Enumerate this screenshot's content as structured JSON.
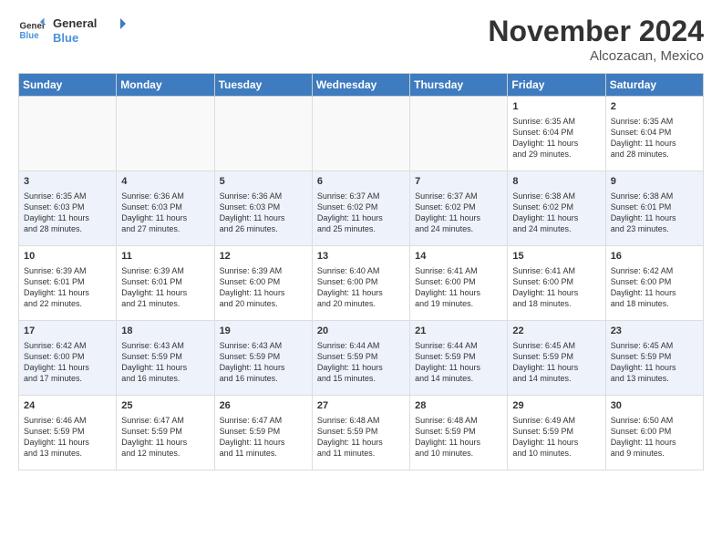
{
  "header": {
    "logo_general": "General",
    "logo_blue": "Blue",
    "month_title": "November 2024",
    "location": "Alcozacan, Mexico"
  },
  "weekdays": [
    "Sunday",
    "Monday",
    "Tuesday",
    "Wednesday",
    "Thursday",
    "Friday",
    "Saturday"
  ],
  "weeks": [
    [
      {
        "day": "",
        "info": ""
      },
      {
        "day": "",
        "info": ""
      },
      {
        "day": "",
        "info": ""
      },
      {
        "day": "",
        "info": ""
      },
      {
        "day": "",
        "info": ""
      },
      {
        "day": "1",
        "info": "Sunrise: 6:35 AM\nSunset: 6:04 PM\nDaylight: 11 hours\nand 29 minutes."
      },
      {
        "day": "2",
        "info": "Sunrise: 6:35 AM\nSunset: 6:04 PM\nDaylight: 11 hours\nand 28 minutes."
      }
    ],
    [
      {
        "day": "3",
        "info": "Sunrise: 6:35 AM\nSunset: 6:03 PM\nDaylight: 11 hours\nand 28 minutes."
      },
      {
        "day": "4",
        "info": "Sunrise: 6:36 AM\nSunset: 6:03 PM\nDaylight: 11 hours\nand 27 minutes."
      },
      {
        "day": "5",
        "info": "Sunrise: 6:36 AM\nSunset: 6:03 PM\nDaylight: 11 hours\nand 26 minutes."
      },
      {
        "day": "6",
        "info": "Sunrise: 6:37 AM\nSunset: 6:02 PM\nDaylight: 11 hours\nand 25 minutes."
      },
      {
        "day": "7",
        "info": "Sunrise: 6:37 AM\nSunset: 6:02 PM\nDaylight: 11 hours\nand 24 minutes."
      },
      {
        "day": "8",
        "info": "Sunrise: 6:38 AM\nSunset: 6:02 PM\nDaylight: 11 hours\nand 24 minutes."
      },
      {
        "day": "9",
        "info": "Sunrise: 6:38 AM\nSunset: 6:01 PM\nDaylight: 11 hours\nand 23 minutes."
      }
    ],
    [
      {
        "day": "10",
        "info": "Sunrise: 6:39 AM\nSunset: 6:01 PM\nDaylight: 11 hours\nand 22 minutes."
      },
      {
        "day": "11",
        "info": "Sunrise: 6:39 AM\nSunset: 6:01 PM\nDaylight: 11 hours\nand 21 minutes."
      },
      {
        "day": "12",
        "info": "Sunrise: 6:39 AM\nSunset: 6:00 PM\nDaylight: 11 hours\nand 20 minutes."
      },
      {
        "day": "13",
        "info": "Sunrise: 6:40 AM\nSunset: 6:00 PM\nDaylight: 11 hours\nand 20 minutes."
      },
      {
        "day": "14",
        "info": "Sunrise: 6:41 AM\nSunset: 6:00 PM\nDaylight: 11 hours\nand 19 minutes."
      },
      {
        "day": "15",
        "info": "Sunrise: 6:41 AM\nSunset: 6:00 PM\nDaylight: 11 hours\nand 18 minutes."
      },
      {
        "day": "16",
        "info": "Sunrise: 6:42 AM\nSunset: 6:00 PM\nDaylight: 11 hours\nand 18 minutes."
      }
    ],
    [
      {
        "day": "17",
        "info": "Sunrise: 6:42 AM\nSunset: 6:00 PM\nDaylight: 11 hours\nand 17 minutes."
      },
      {
        "day": "18",
        "info": "Sunrise: 6:43 AM\nSunset: 5:59 PM\nDaylight: 11 hours\nand 16 minutes."
      },
      {
        "day": "19",
        "info": "Sunrise: 6:43 AM\nSunset: 5:59 PM\nDaylight: 11 hours\nand 16 minutes."
      },
      {
        "day": "20",
        "info": "Sunrise: 6:44 AM\nSunset: 5:59 PM\nDaylight: 11 hours\nand 15 minutes."
      },
      {
        "day": "21",
        "info": "Sunrise: 6:44 AM\nSunset: 5:59 PM\nDaylight: 11 hours\nand 14 minutes."
      },
      {
        "day": "22",
        "info": "Sunrise: 6:45 AM\nSunset: 5:59 PM\nDaylight: 11 hours\nand 14 minutes."
      },
      {
        "day": "23",
        "info": "Sunrise: 6:45 AM\nSunset: 5:59 PM\nDaylight: 11 hours\nand 13 minutes."
      }
    ],
    [
      {
        "day": "24",
        "info": "Sunrise: 6:46 AM\nSunset: 5:59 PM\nDaylight: 11 hours\nand 13 minutes."
      },
      {
        "day": "25",
        "info": "Sunrise: 6:47 AM\nSunset: 5:59 PM\nDaylight: 11 hours\nand 12 minutes."
      },
      {
        "day": "26",
        "info": "Sunrise: 6:47 AM\nSunset: 5:59 PM\nDaylight: 11 hours\nand 11 minutes."
      },
      {
        "day": "27",
        "info": "Sunrise: 6:48 AM\nSunset: 5:59 PM\nDaylight: 11 hours\nand 11 minutes."
      },
      {
        "day": "28",
        "info": "Sunrise: 6:48 AM\nSunset: 5:59 PM\nDaylight: 11 hours\nand 10 minutes."
      },
      {
        "day": "29",
        "info": "Sunrise: 6:49 AM\nSunset: 5:59 PM\nDaylight: 11 hours\nand 10 minutes."
      },
      {
        "day": "30",
        "info": "Sunrise: 6:50 AM\nSunset: 6:00 PM\nDaylight: 11 hours\nand 9 minutes."
      }
    ]
  ]
}
